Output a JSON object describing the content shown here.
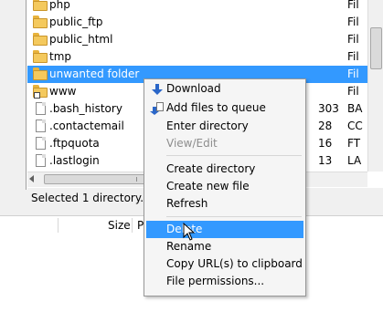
{
  "files": [
    {
      "name": "php",
      "type": "folder",
      "size": "",
      "kind": "Fil",
      "selected": false
    },
    {
      "name": "public_ftp",
      "type": "folder",
      "size": "",
      "kind": "Fil",
      "selected": false
    },
    {
      "name": "public_html",
      "type": "folder",
      "size": "",
      "kind": "Fil",
      "selected": false
    },
    {
      "name": "tmp",
      "type": "folder",
      "size": "",
      "kind": "Fil",
      "selected": false
    },
    {
      "name": "unwanted folder",
      "type": "folder",
      "size": "",
      "kind": "Fil",
      "selected": true
    },
    {
      "name": "www",
      "type": "link",
      "size": "",
      "kind": "Fil",
      "selected": false
    },
    {
      "name": ".bash_history",
      "type": "file",
      "size": "303",
      "kind": "BA",
      "selected": false
    },
    {
      "name": ".contactemail",
      "type": "file",
      "size": "28",
      "kind": "CC",
      "selected": false
    },
    {
      "name": ".ftpquota",
      "type": "file",
      "size": "16",
      "kind": "FT",
      "selected": false
    },
    {
      "name": ".lastlogin",
      "type": "file",
      "size": "13",
      "kind": "LA",
      "selected": false
    }
  ],
  "status": {
    "text": "Selected 1 directory."
  },
  "queue_header": {
    "size": "Size",
    "priority": "P"
  },
  "context_menu": {
    "items": [
      {
        "label": "Download",
        "icon": "download-icon",
        "disabled": false,
        "hover": false
      },
      {
        "label": "Add files to queue",
        "icon": "add-to-queue-icon",
        "disabled": false,
        "hover": false
      },
      {
        "label": "Enter directory",
        "icon": "",
        "disabled": false,
        "hover": false
      },
      {
        "label": "View/Edit",
        "icon": "",
        "disabled": true,
        "hover": false
      },
      {
        "label": "Create directory",
        "icon": "",
        "disabled": false,
        "hover": false
      },
      {
        "label": "Create new file",
        "icon": "",
        "disabled": false,
        "hover": false
      },
      {
        "label": "Refresh",
        "icon": "",
        "disabled": false,
        "hover": false
      },
      {
        "label": "Delete",
        "icon": "",
        "disabled": false,
        "hover": true
      },
      {
        "label": "Rename",
        "icon": "",
        "disabled": false,
        "hover": false
      },
      {
        "label": "Copy URL(s) to clipboard",
        "icon": "",
        "disabled": false,
        "hover": false
      },
      {
        "label": "File permissions...",
        "icon": "",
        "disabled": false,
        "hover": false
      }
    ]
  },
  "colors": {
    "selection": "#3399ff",
    "folder": "#f4c95d"
  }
}
